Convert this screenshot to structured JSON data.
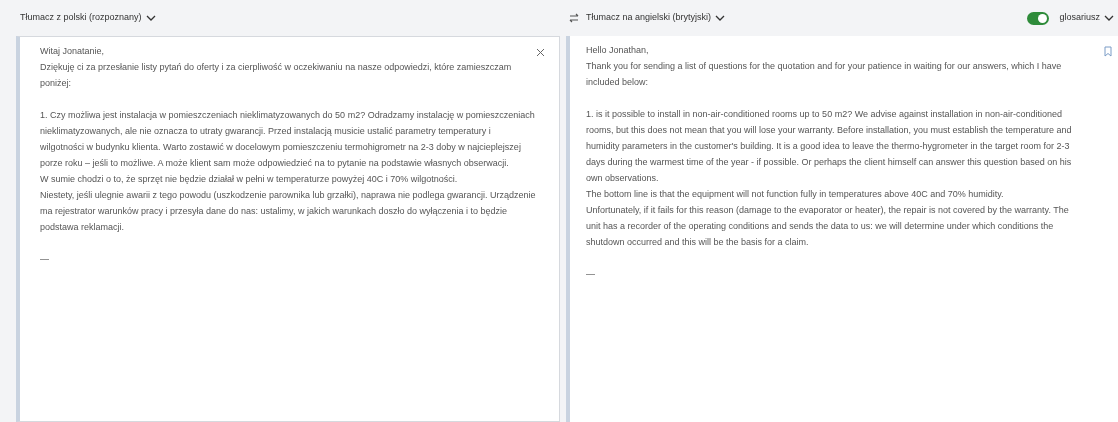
{
  "source": {
    "language": "Tłumacz z polski (rozpoznany)",
    "groups": [
      [
        "Witaj Jonatanie,",
        "Dziękuję ci za przesłanie listy pytań do oferty i za cierpliwość w oczekiwaniu na nasze odpowiedzi, które zamieszczam poniżej:"
      ],
      [
        "1. Czy możliwa jest instalacja w pomieszczeniach nieklimatyzowanych do 50 m2? Odradzamy instalację w pomieszczeniach nieklimatyzowanych, ale nie oznacza to utraty gwarancji. Przed instalacją musicie ustalić parametry temperatury i wilgotności w budynku klienta. Warto zostawić w docelowym pomieszczeniu termohigrometr na 2-3 doby w najcieplejszej porze roku – jeśli to możliwe. A może klient sam może odpowiedzieć na to pytanie na podstawie własnych obserwacji.",
        "W sumie chodzi o to, że sprzęt nie będzie działał w pełni w temperaturze powyżej 40C i 70% wilgotności.",
        "Niestety, jeśli ulegnie awarii z tego powodu (uszkodzenie parownika lub grzałki), naprawa nie podlega gwarancji. Urządzenie ma rejestrator warunków pracy i przesyła dane do nas: ustalimy, w jakich warunkach doszło do wyłączenia i to będzie podstawa reklamacji."
      ],
      [
        "—"
      ]
    ]
  },
  "target": {
    "language": "Tłumacz na angielski (brytyjski)",
    "glossary": {
      "label": "glosariusz",
      "on": true
    },
    "groups": [
      [
        "Hello Jonathan,",
        "Thank you for sending a list of questions for the quotation and for your patience in waiting for our answers, which I have included below:"
      ],
      [
        "1. is it possible to install in non-air-conditioned rooms up to 50 m2? We advise against installation in non-air-conditioned rooms, but this does not mean that you will lose your warranty. Before installation, you must establish the temperature and humidity parameters in the customer's building. It is a good idea to leave the thermo-hygrometer in the target room for 2-3 days during the warmest time of the year - if possible. Or perhaps the client himself can answer this question based on his own observations.",
        "The bottom line is that the equipment will not function fully in temperatures above 40C and 70% humidity.",
        "Unfortunately, if it fails for this reason (damage to the evaporator or heater), the repair is not covered by the warranty. The unit has a recorder of the operating conditions and sends the data to us: we will determine under which conditions the shutdown occurred and this will be the basis for a claim."
      ],
      [
        "—"
      ]
    ]
  }
}
